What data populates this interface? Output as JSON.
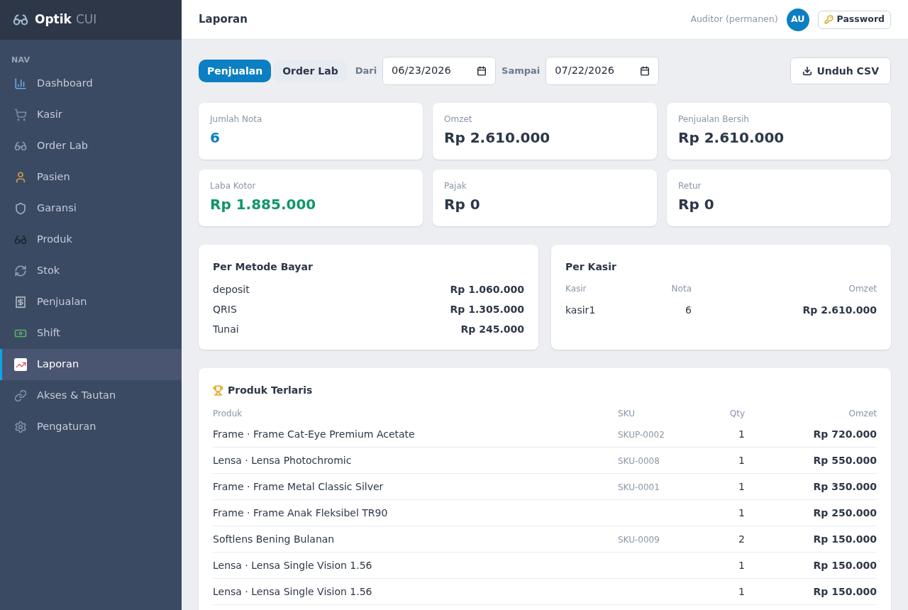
{
  "sidebar": {
    "brand": {
      "name": "Optik",
      "suffix": "CUI"
    },
    "section_label": "NAV",
    "items": [
      {
        "label": "Dashboard",
        "selected": false
      },
      {
        "label": "Kasir",
        "selected": false
      },
      {
        "label": "Order Lab",
        "selected": false
      },
      {
        "label": "Pasien",
        "selected": false
      },
      {
        "label": "Garansi",
        "selected": false
      },
      {
        "label": "Produk",
        "selected": false
      },
      {
        "label": "Stok",
        "selected": false
      },
      {
        "label": "Penjualan",
        "selected": false
      },
      {
        "label": "Shift",
        "selected": false
      },
      {
        "label": "Laporan",
        "selected": true
      },
      {
        "label": "Akses & Tautan",
        "selected": false
      },
      {
        "label": "Pengaturan",
        "selected": false
      }
    ]
  },
  "header": {
    "title": "Laporan",
    "user_role": "Auditor (permanen)",
    "avatar_initials": "AU",
    "password_button": "Password"
  },
  "toolbar": {
    "tabs": [
      {
        "label": "Penjualan",
        "selected": true
      },
      {
        "label": "Order Lab",
        "selected": false
      }
    ],
    "date_from": {
      "label": "Dari",
      "value": "06/23/2026"
    },
    "date_to": {
      "label": "Sampai",
      "value": "07/22/2026"
    },
    "export_button": "Unduh CSV"
  },
  "stats": [
    {
      "label": "Jumlah Nota",
      "value": "6",
      "color": "#0b7fc2"
    },
    {
      "label": "Omzet",
      "value": "Rp 2.610.000",
      "color": "#2d3748"
    },
    {
      "label": "Penjualan Bersih",
      "value": "Rp 2.610.000",
      "color": "#2d3748"
    },
    {
      "label": "Laba Kotor",
      "value": "Rp 1.885.000",
      "color": "#10976a"
    },
    {
      "label": "Pajak",
      "value": "Rp 0",
      "color": "#2d3748"
    },
    {
      "label": "Retur",
      "value": "Rp 0",
      "color": "#2d3748"
    }
  ],
  "payment_methods": {
    "title": "Per Metode Bayar",
    "rows": [
      {
        "method": "deposit",
        "amount": "Rp 1.060.000"
      },
      {
        "method": "QRIS",
        "amount": "Rp 1.305.000"
      },
      {
        "method": "Tunai",
        "amount": "Rp 245.000"
      }
    ]
  },
  "cashiers": {
    "title": "Per Kasir",
    "columns": [
      "Kasir",
      "Nota",
      "Omzet"
    ],
    "rows": [
      {
        "kasir": "kasir1",
        "nota": "6",
        "omzet": "Rp 2.610.000"
      }
    ]
  },
  "top_products": {
    "title": "Produk Terlaris",
    "columns": [
      "Produk",
      "SKU",
      "Qty",
      "Omzet"
    ],
    "rows": [
      {
        "produk": "Frame · Frame Cat-Eye Premium Acetate",
        "sku": "SKUP-0002",
        "qty": "1",
        "omzet": "Rp 720.000"
      },
      {
        "produk": "Lensa · Lensa Photochromic",
        "sku": "SKU-0008",
        "qty": "1",
        "omzet": "Rp 550.000"
      },
      {
        "produk": "Frame · Frame Metal Classic Silver",
        "sku": "SKU-0001",
        "qty": "1",
        "omzet": "Rp 350.000"
      },
      {
        "produk": "Frame · Frame Anak Fleksibel TR90",
        "qty": "1",
        "omzet": "Rp 250.000"
      },
      {
        "produk": "Softlens Bening Bulanan",
        "sku": "SKU-0009",
        "qty": "2",
        "omzet": "Rp 150.000"
      },
      {
        "produk": "Lensa · Lensa Single Vision 1.56",
        "qty": "1",
        "omzet": "Rp 150.000"
      },
      {
        "produk": "Lensa · Lensa Single Vision 1.56",
        "qty": "1",
        "omzet": "Rp 150.000"
      }
    ]
  }
}
